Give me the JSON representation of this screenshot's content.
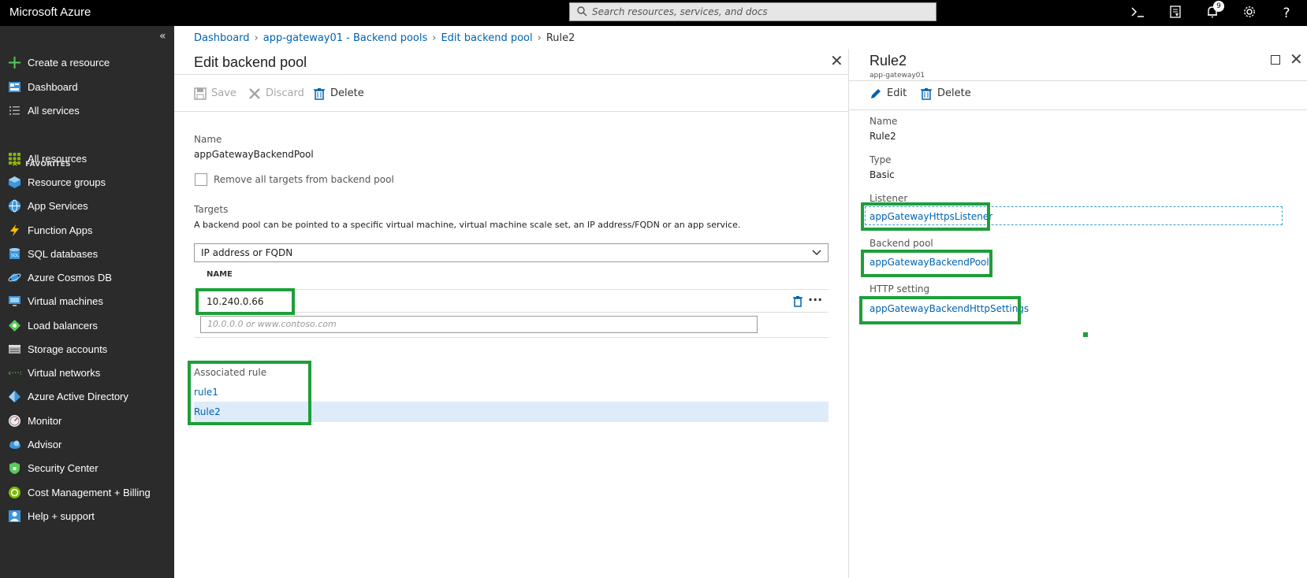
{
  "topbar": {
    "brand": "Microsoft Azure",
    "search_placeholder": "Search resources, services, and docs",
    "notification_count": "9",
    "help": "?"
  },
  "sidebar": {
    "collapse": "«",
    "items_top": [
      {
        "label": "Create a resource",
        "icon": "plus-icon"
      },
      {
        "label": "Dashboard",
        "icon": "dashboard-icon"
      },
      {
        "label": "All services",
        "icon": "list-icon"
      }
    ],
    "favorites_label": "FAVORITES",
    "items": [
      {
        "label": "All resources",
        "icon": "grid-icon"
      },
      {
        "label": "Resource groups",
        "icon": "cube-icon"
      },
      {
        "label": "App Services",
        "icon": "globe-icon"
      },
      {
        "label": "Function Apps",
        "icon": "lightning-icon"
      },
      {
        "label": "SQL databases",
        "icon": "database-icon"
      },
      {
        "label": "Azure Cosmos DB",
        "icon": "planet-icon"
      },
      {
        "label": "Virtual machines",
        "icon": "monitor-icon"
      },
      {
        "label": "Load balancers",
        "icon": "diamond-icon"
      },
      {
        "label": "Storage accounts",
        "icon": "storage-icon"
      },
      {
        "label": "Virtual networks",
        "icon": "network-icon"
      },
      {
        "label": "Azure Active Directory",
        "icon": "pyramid-icon"
      },
      {
        "label": "Monitor",
        "icon": "gauge-icon"
      },
      {
        "label": "Advisor",
        "icon": "cloud-icon"
      },
      {
        "label": "Security Center",
        "icon": "shield-icon"
      },
      {
        "label": "Cost Management + Billing",
        "icon": "coin-icon"
      },
      {
        "label": "Help + support",
        "icon": "person-icon"
      }
    ]
  },
  "breadcrumb": {
    "items": [
      "Dashboard",
      "app-gateway01 - Backend pools",
      "Edit backend pool"
    ],
    "current": "Rule2"
  },
  "edit_pool": {
    "title": "Edit backend pool",
    "toolbar": {
      "save": "Save",
      "discard": "Discard",
      "delete": "Delete"
    },
    "name_label": "Name",
    "name_value": "appGatewayBackendPool",
    "remove_all_label": "Remove all targets from backend pool",
    "targets_label": "Targets",
    "targets_desc": "A backend pool can be pointed to a specific virtual machine, virtual machine scale set, an IP address/FQDN or an app service.",
    "target_type": "IP address or FQDN",
    "table_header": "NAME",
    "target_value": "10.240.0.66",
    "more": "···",
    "new_target_placeholder": "10.0.0.0 or www.contoso.com",
    "associated_rule_label": "Associated rule",
    "rules": [
      "rule1",
      "Rule2"
    ]
  },
  "rule_panel": {
    "title": "Rule2",
    "subtitle": "app-gateway01",
    "toolbar": {
      "edit": "Edit",
      "delete": "Delete"
    },
    "name_label": "Name",
    "name_value": "Rule2",
    "type_label": "Type",
    "type_value": "Basic",
    "listener_label": "Listener",
    "listener_value": "appGatewayHttpsListener",
    "backend_pool_label": "Backend pool",
    "backend_pool_value": "appGatewayBackendPool",
    "http_setting_label": "HTTP setting",
    "http_setting_value": "appGatewayBackendHttpSettings"
  },
  "colors": {
    "highlight": "#1e9e3a",
    "link": "#0063b1",
    "sidebar_bg": "#2b2b2b",
    "selected_row": "#deecf9"
  }
}
